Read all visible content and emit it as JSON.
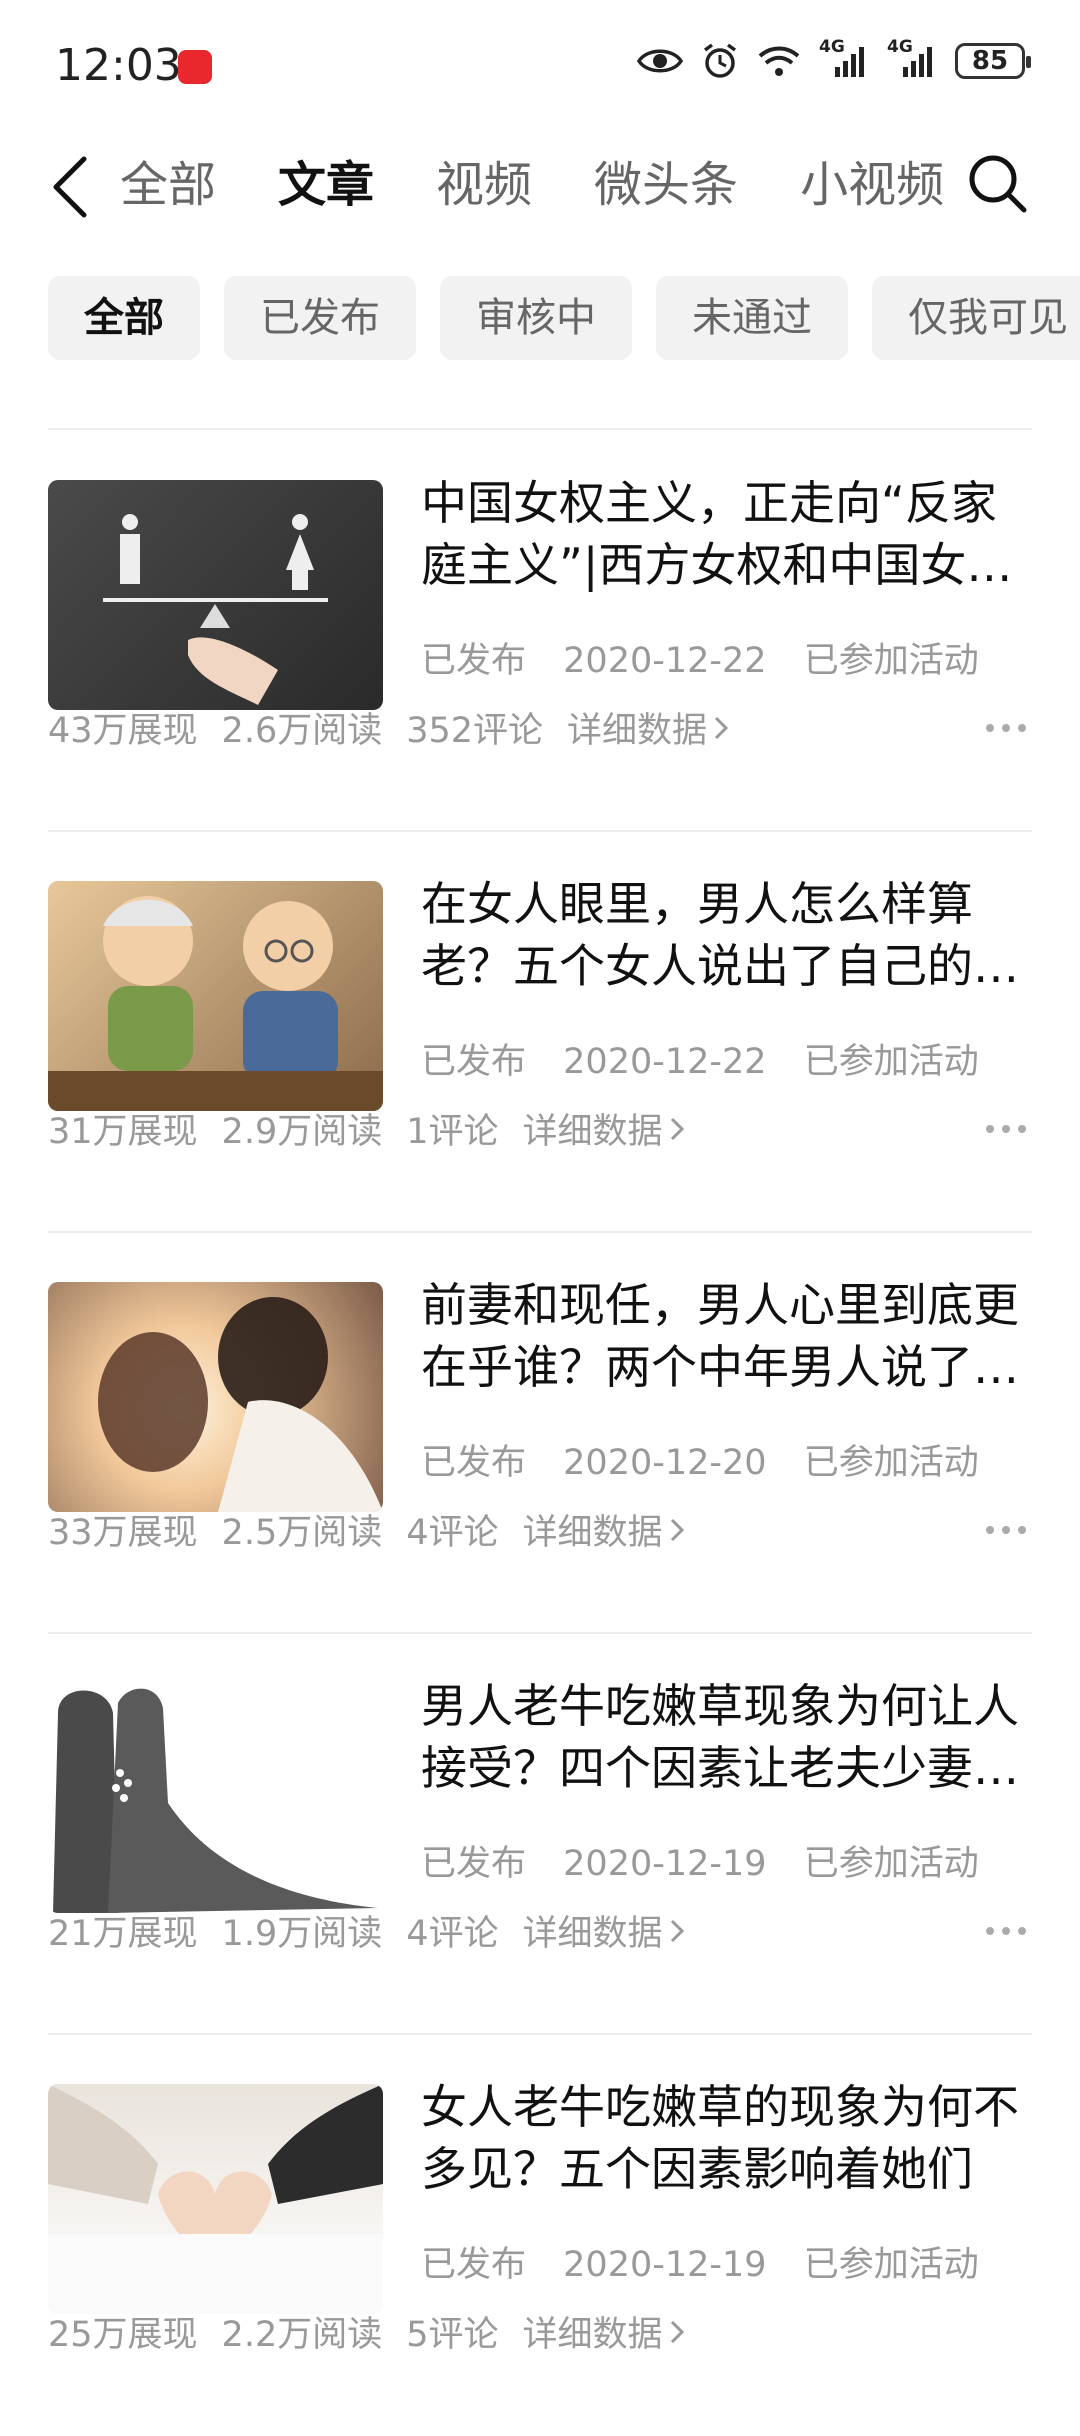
{
  "status_bar": {
    "time": "12:03",
    "battery": "85",
    "network_1": "4G",
    "network_2": "4G",
    "icons": [
      "eye-icon",
      "alarm-icon",
      "wifi-icon",
      "signal-icon",
      "signal-icon",
      "battery-icon"
    ]
  },
  "nav": {
    "tabs": [
      {
        "label": "全部",
        "active": false
      },
      {
        "label": "文章",
        "active": true
      },
      {
        "label": "视频",
        "active": false
      },
      {
        "label": "微头条",
        "active": false
      },
      {
        "label": "小视频",
        "active": false
      }
    ]
  },
  "filters": [
    {
      "label": "全部",
      "active": true
    },
    {
      "label": "已发布",
      "active": false
    },
    {
      "label": "审核中",
      "active": false
    },
    {
      "label": "未通过",
      "active": false
    },
    {
      "label": "仅我可见",
      "active": false
    }
  ],
  "articles": [
    {
      "title": "中国女权主义，正走向“反家庭主义”|西方女权和中国女权的区别",
      "status": "已发布",
      "date": "2020-12-22",
      "activity": "已参加活动",
      "views": "43万展现",
      "reads": "2.6万阅读",
      "comments": "352评论",
      "detail": "详细数据",
      "thumb_colors": [
        "#3d3d3d",
        "#6b6b6b"
      ]
    },
    {
      "title": "在女人眼里，男人怎么样算老？五个女人说出了自己的看法",
      "status": "已发布",
      "date": "2020-12-22",
      "activity": "已参加活动",
      "views": "31万展现",
      "reads": "2.9万阅读",
      "comments": "1评论",
      "detail": "详细数据",
      "thumb_colors": [
        "#c9a36e",
        "#5d6f8a"
      ]
    },
    {
      "title": "前妻和现任，男人心里到底更在乎谁？两个中年男人说了实话",
      "status": "已发布",
      "date": "2020-12-20",
      "activity": "已参加活动",
      "views": "33万展现",
      "reads": "2.5万阅读",
      "comments": "4评论",
      "detail": "详细数据",
      "thumb_colors": [
        "#f4d9b5",
        "#6b4a38"
      ]
    },
    {
      "title": "男人老牛吃嫩草现象为何让人接受？四个因素让老夫少妻更多",
      "status": "已发布",
      "date": "2020-12-19",
      "activity": "已参加活动",
      "views": "21万展现",
      "reads": "1.9万阅读",
      "comments": "4评论",
      "detail": "详细数据",
      "thumb_colors": [
        "#ffffff",
        "#444444"
      ]
    },
    {
      "title": "女人老牛吃嫩草的现象为何不多见？五个因素影响着她们",
      "status": "已发布",
      "date": "2020-12-19",
      "activity": "已参加活动",
      "views": "25万展现",
      "reads": "2.2万阅读",
      "comments": "5评论",
      "detail": "详细数据",
      "thumb_colors": [
        "#eeeeee",
        "#c9b8a8"
      ]
    }
  ]
}
